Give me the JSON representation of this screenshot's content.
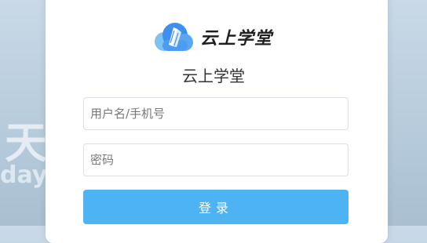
{
  "background": {
    "text_cn": "天",
    "text_en": "day"
  },
  "brand": {
    "logo_text": "云上学堂",
    "subtitle": "云上学堂",
    "accent": "#4db3f2"
  },
  "form": {
    "username_placeholder": "用户名/手机号",
    "password_placeholder": "密码",
    "login_label": "登录"
  }
}
